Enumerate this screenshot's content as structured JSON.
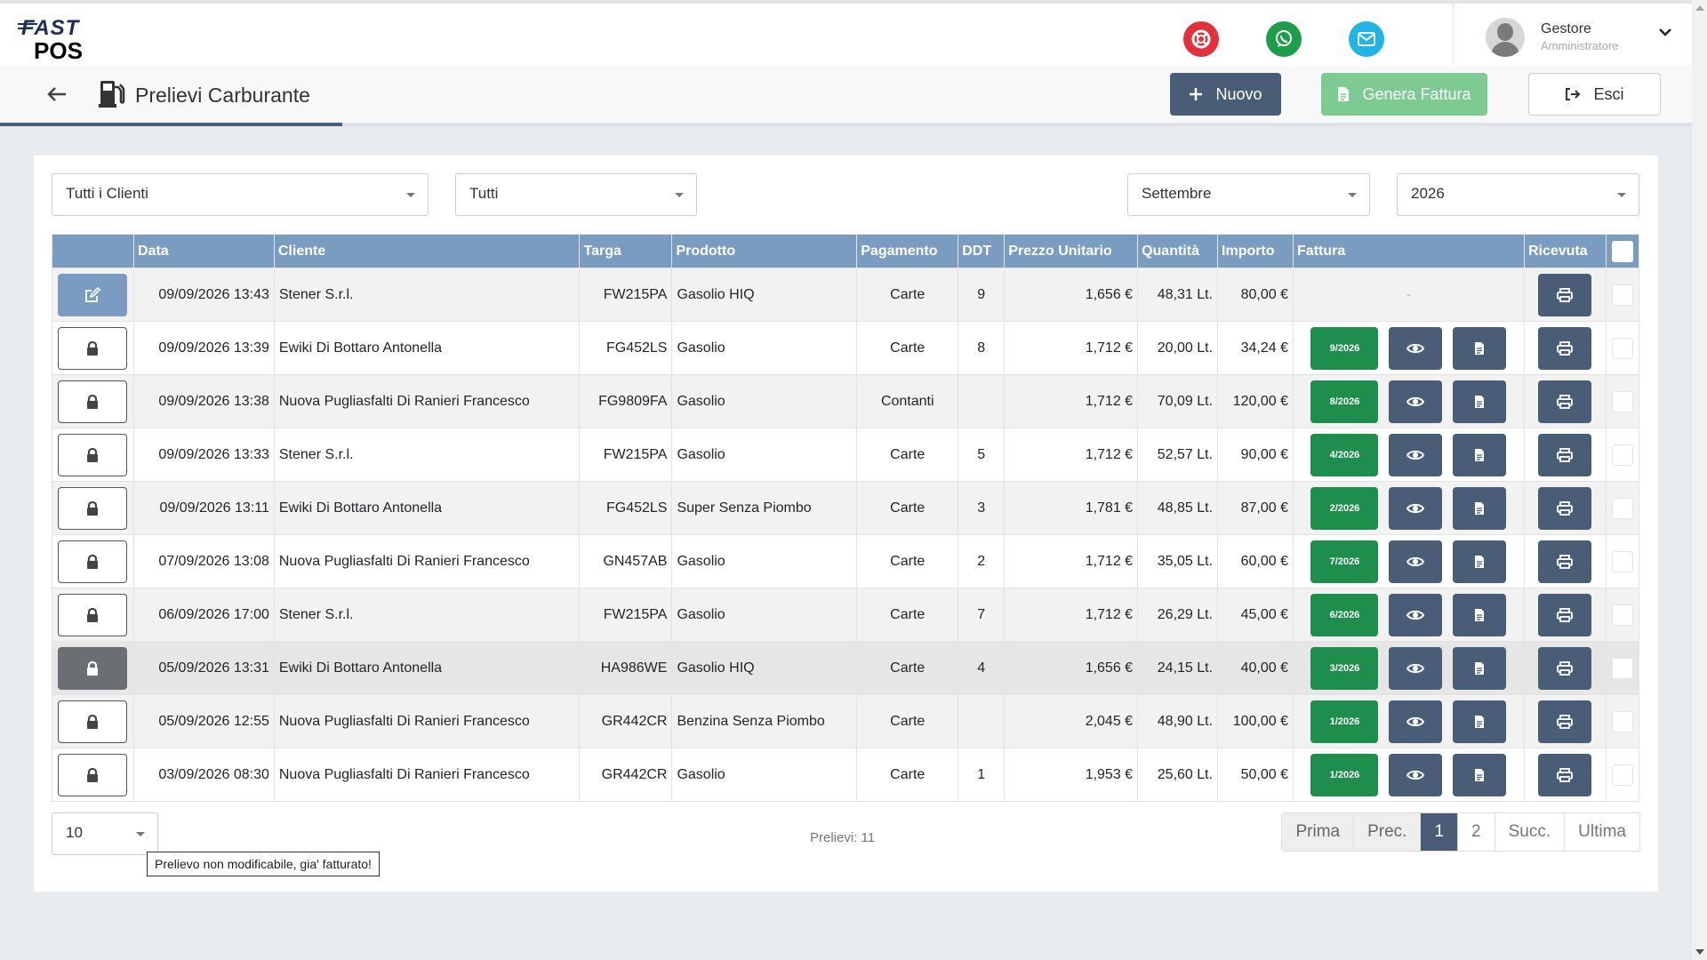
{
  "header": {
    "logo_top": "FAST",
    "logo_bottom": "POS",
    "user_name": "Gestore",
    "user_role": "Amministratore",
    "icons": [
      "lifebuoy-icon",
      "whatsapp-icon",
      "mail-icon"
    ],
    "colors": {
      "support": "#e4303b",
      "whatsapp": "#1e9e4a",
      "mail": "#1fb5e6"
    }
  },
  "titlebar": {
    "title": "Prelievi Carburante",
    "nuovo_label": "Nuovo",
    "fattura_label": "Genera Fattura",
    "esci_label": "Esci"
  },
  "filters": {
    "clienti": "Tutti i Clienti",
    "tipo": "Tutti",
    "mese": "Settembre",
    "anno": "2026"
  },
  "table": {
    "headers": [
      "",
      "Data",
      "Cliente",
      "Targa",
      "Prodotto",
      "Pagamento",
      "DDT",
      "Prezzo Unitario",
      "Quantità",
      "Importo",
      "Fattura",
      "Ricevuta",
      ""
    ],
    "rows": [
      {
        "data": "09/09/2026 13:43",
        "cliente": "Stener S.r.l.",
        "targa": "FW215PA",
        "prodotto": "Gasolio HIQ",
        "pagamento": "Carte",
        "ddt": "9",
        "prezzo": "1,656 €",
        "quantita": "48,31 Lt.",
        "importo": "80,00 €",
        "fattura": "-"
      },
      {
        "data": "09/09/2026 13:39",
        "cliente": "Ewiki Di Bottaro Antonella",
        "targa": "FG452LS",
        "prodotto": "Gasolio",
        "pagamento": "Carte",
        "ddt": "8",
        "prezzo": "1,712 €",
        "quantita": "20,00 Lt.",
        "importo": "34,24 €",
        "fattura": "9/2026"
      },
      {
        "data": "09/09/2026 13:38",
        "cliente": "Nuova Pugliasfalti Di Ranieri Francesco",
        "targa": "FG9809FA",
        "prodotto": "Gasolio",
        "pagamento": "Contanti",
        "ddt": "",
        "prezzo": "1,712 €",
        "quantita": "70,09 Lt.",
        "importo": "120,00 €",
        "fattura": "8/2026"
      },
      {
        "data": "09/09/2026 13:33",
        "cliente": "Stener S.r.l.",
        "targa": "FW215PA",
        "prodotto": "Gasolio",
        "pagamento": "Carte",
        "ddt": "5",
        "prezzo": "1,712 €",
        "quantita": "52,57 Lt.",
        "importo": "90,00 €",
        "fattura": "4/2026"
      },
      {
        "data": "09/09/2026 13:11",
        "cliente": "Ewiki Di Bottaro Antonella",
        "targa": "FG452LS",
        "prodotto": "Super Senza Piombo",
        "pagamento": "Carte",
        "ddt": "3",
        "prezzo": "1,781 €",
        "quantita": "48,85 Lt.",
        "importo": "87,00 €",
        "fattura": "2/2026"
      },
      {
        "data": "07/09/2026 13:08",
        "cliente": "Nuova Pugliasfalti Di Ranieri Francesco",
        "targa": "GN457AB",
        "prodotto": "Gasolio",
        "pagamento": "Carte",
        "ddt": "2",
        "prezzo": "1,712 €",
        "quantita": "35,05 Lt.",
        "importo": "60,00 €",
        "fattura": "7/2026"
      },
      {
        "data": "06/09/2026 17:00",
        "cliente": "Stener S.r.l.",
        "targa": "FW215PA",
        "prodotto": "Gasolio",
        "pagamento": "Carte",
        "ddt": "7",
        "prezzo": "1,712 €",
        "quantita": "26,29 Lt.",
        "importo": "45,00 €",
        "fattura": "6/2026"
      },
      {
        "data": "05/09/2026 13:31",
        "cliente": "Ewiki Di Bottaro Antonella",
        "targa": "HA986WE",
        "prodotto": "Gasolio HIQ",
        "pagamento": "Carte",
        "ddt": "4",
        "prezzo": "1,656 €",
        "quantita": "24,15 Lt.",
        "importo": "40,00 €",
        "fattura": "3/2026"
      },
      {
        "data": "05/09/2026 12:55",
        "cliente": "Nuova Pugliasfalti Di Ranieri Francesco",
        "targa": "GR442CR",
        "prodotto": "Benzina Senza Piombo",
        "pagamento": "Carte",
        "ddt": "",
        "prezzo": "2,045 €",
        "quantita": "48,90 Lt.",
        "importo": "100,00 €",
        "fattura": "1/2026"
      },
      {
        "data": "03/09/2026 08:30",
        "cliente": "Nuova Pugliasfalti Di Ranieri Francesco",
        "targa": "GR442CR",
        "prodotto": "Gasolio",
        "pagamento": "Carte",
        "ddt": "1",
        "prezzo": "1,953 €",
        "quantita": "25,60 Lt.",
        "importo": "50,00 €",
        "fattura": "1/2026"
      }
    ]
  },
  "tooltip": "Prelievo non modificabile, gia' fatturato!",
  "footer": {
    "page_size": "10",
    "count": "Prelievi: 11",
    "pager": [
      "Prima",
      "Prec.",
      "1",
      "2",
      "Succ.",
      "Ultima"
    ]
  }
}
